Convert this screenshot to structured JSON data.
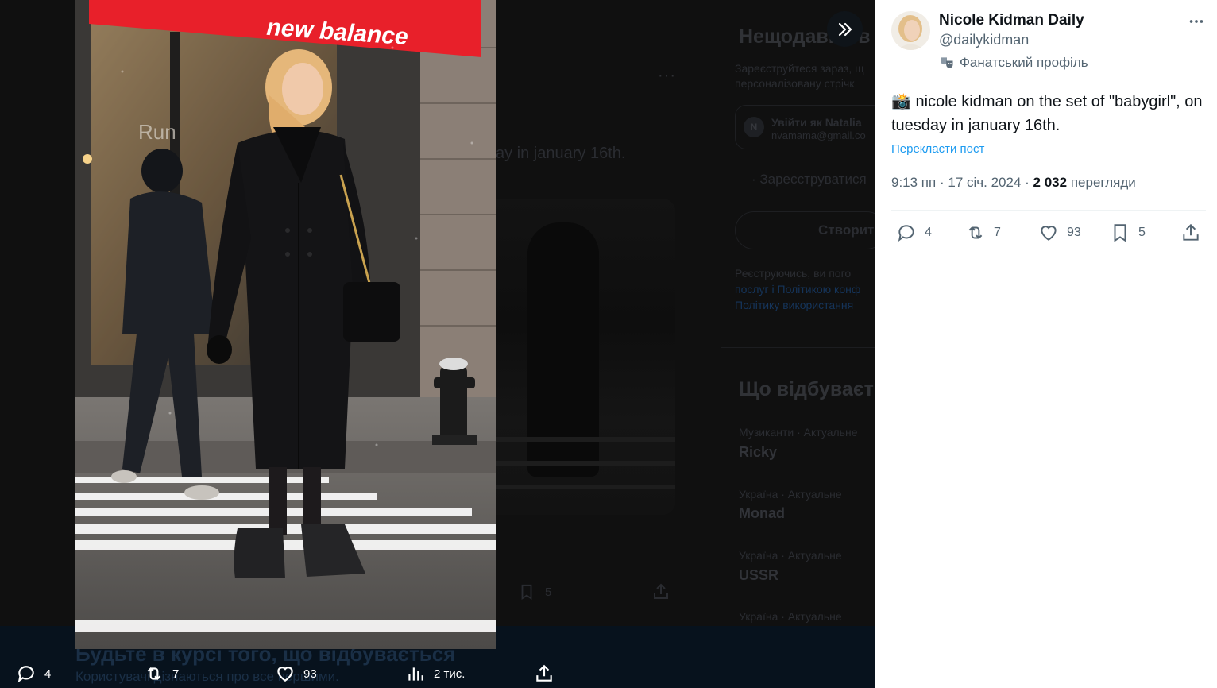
{
  "background": {
    "heading_recent": "Нещодавно в",
    "register_line1": "Зареєструйтеся зараз, щ",
    "register_line2": "персоналізовану стрічк",
    "login_as": "Увійти як Natalia",
    "login_email": "nvamama@gmail.co",
    "register_button": "· Зареєструватися",
    "create_account": "Створити",
    "terms_line1": "Реєструючись, ви пого",
    "terms_line2": "послуг і Політикою конф",
    "terms_line3": "Політику використання",
    "tweet_fragment": "ay in january 16th.",
    "trending_heading": "Що відбуваєт",
    "trends": [
      {
        "category": "Музиканти · Актуальне",
        "name": "Ricky"
      },
      {
        "category": "Україна · Актуальне",
        "name": "Monad"
      },
      {
        "category": "Україна · Актуальне",
        "name": "USSR"
      },
      {
        "category": "Україна · Актуальне",
        "name": ""
      }
    ],
    "bookmark_count_dim": "5",
    "banner_title": "Будьте в курсі того, що відбувається",
    "banner_subtitle": "Користувачі дізнаються про все першими."
  },
  "photo": {
    "store_sign": "new balance",
    "store_window_text": "Run"
  },
  "bottom_bar": {
    "replies": "4",
    "reposts": "7",
    "likes": "93",
    "views": "2 тис."
  },
  "tweet": {
    "author_name": "Nicole Kidman Daily",
    "author_handle": "@dailykidman",
    "fan_badge_icon": "theater-masks-icon",
    "fan_badge_label": "Фанатський профіль",
    "text_emoji": "📸",
    "text": "nicole kidman on the set of \"babygirl\", on tuesday in january 16th.",
    "translate_label": "Перекласти пост",
    "time": "9:13 пп",
    "date": "17 січ. 2024",
    "views_count": "2 032",
    "views_label": "перегляди",
    "separator": "·"
  },
  "actions": {
    "replies": "4",
    "reposts": "7",
    "likes": "93",
    "bookmarks": "5"
  },
  "colors": {
    "accent": "#1d9bf0",
    "text_primary": "#0f1419",
    "text_secondary": "#536471",
    "sign_red": "#e8202a"
  }
}
